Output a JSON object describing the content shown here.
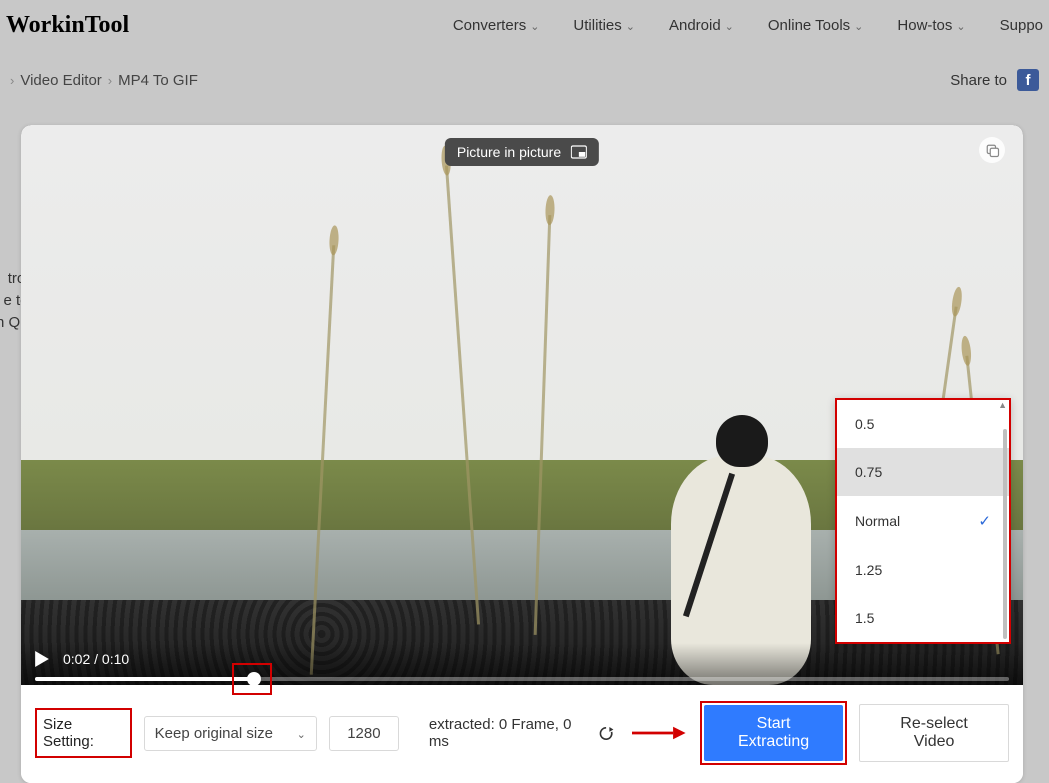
{
  "logo": "WorkinTool",
  "nav": {
    "converters": "Converters",
    "utilities": "Utilities",
    "android": "Android",
    "online": "Online Tools",
    "howtos": "How-tos",
    "support": "Suppo"
  },
  "breadcrumb": {
    "parent": "Video Editor",
    "current": "MP4 To GIF"
  },
  "share_label": "Share to",
  "pip_label": "Picture in picture",
  "speed_menu": {
    "items": [
      "0.5",
      "0.75",
      "Normal",
      "1.25",
      "1.5"
    ],
    "selected_index": 2
  },
  "video": {
    "current": "0:02",
    "duration": "0:10",
    "progress_pct": 22.5
  },
  "toolbar": {
    "size_label": "Size Setting:",
    "size_select": "Keep original size",
    "size_value": "1280",
    "extracted_label": "extracted: 0 Frame, 0 ms",
    "start_btn": "Start Extracting",
    "reselect_btn": "Re-select Video"
  },
  "side_text": [
    "trol",
    "e to",
    "n Qu"
  ]
}
